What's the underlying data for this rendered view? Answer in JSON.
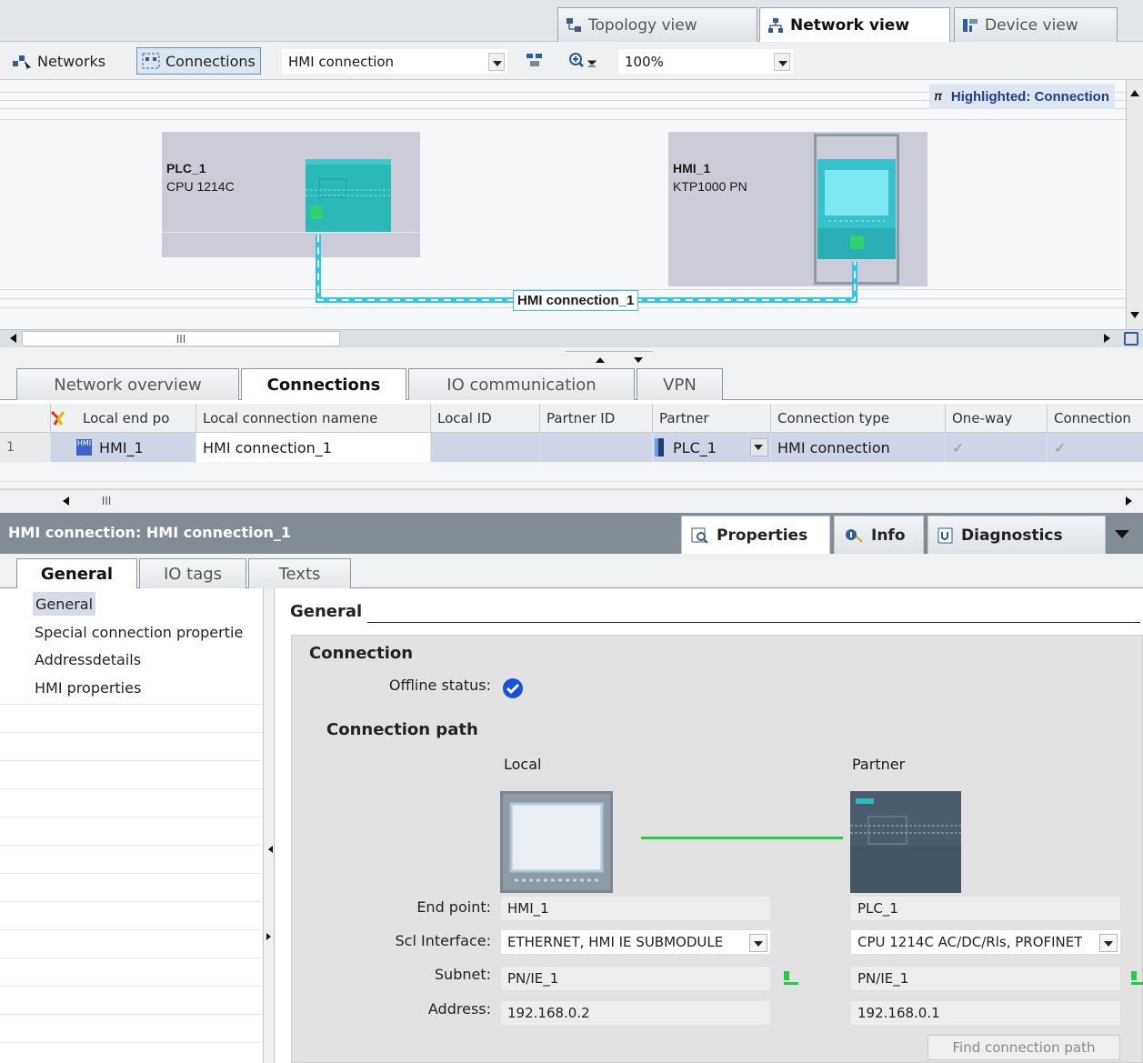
{
  "view_tabs": [
    {
      "label": "Topology view",
      "icon": "topology-icon"
    },
    {
      "label": "Network view",
      "icon": "network-icon"
    },
    {
      "label": "Device view",
      "icon": "device-icon"
    }
  ],
  "toolbar": {
    "networks_label": "Networks",
    "connections_label": "Connections",
    "connection_type": "HMI connection",
    "zoom": "100%"
  },
  "canvas": {
    "highlight_label": "Highlighted: Connection",
    "connection_label": "HMI connection_1",
    "devices": [
      {
        "name": "PLC_1",
        "type": "CPU 1214C"
      },
      {
        "name": "HMI_1",
        "type": "KTP1000 PN"
      }
    ],
    "hscroll_thumb": "III"
  },
  "editor_tabs": [
    "Network overview",
    "Connections",
    "IO communication",
    "VPN"
  ],
  "table": {
    "columns": [
      "Local end po",
      "Local connection namene",
      "Local ID",
      "Partner ID",
      "Partner",
      "Connection type",
      "One-way",
      "Connection"
    ],
    "rows": [
      {
        "index": "1",
        "local_end": "HMI_1",
        "local_name": "HMI connection_1",
        "local_id": "",
        "partner_id": "",
        "partner": "PLC_1",
        "type": "HMI connection",
        "one_way": "✓",
        "connection": "✓"
      }
    ],
    "scroll_thumb": "III"
  },
  "inspector": {
    "title": "HMI connection: HMI connection_1",
    "tabs": [
      "Properties",
      "Info",
      "Diagnostics"
    ],
    "subtabs": [
      "General",
      "IO tags",
      "Texts"
    ],
    "nav": [
      "General",
      "Special connection propertie",
      "Addressdetails",
      "HMI properties"
    ],
    "section": "General",
    "connection_heading": "Connection",
    "offline_status_label": "Offline status:",
    "path_heading": "Connection path",
    "local_label": "Local",
    "partner_label": "Partner",
    "labels": {
      "endpoint": "End point:",
      "interface": "Scl Interface:",
      "subnet": "Subnet:",
      "address": "Address:"
    },
    "local": {
      "endpoint": "HMI_1",
      "interface": "ETHERNET, HMI IE SUBMODULE",
      "subnet": "PN/IE_1",
      "address": "192.168.0.2"
    },
    "partner": {
      "endpoint": "PLC_1",
      "interface": "CPU 1214C AC/DC/Rls, PROFINET",
      "subnet": "PN/IE_1",
      "address": "192.168.0.1"
    },
    "find_path_label": "Find connection path"
  },
  "colors": {
    "connection_line": "#3fd0ee",
    "port_green": "#22cc66",
    "selected_row": "#cdd5e6",
    "header_bar": "#828c96"
  }
}
